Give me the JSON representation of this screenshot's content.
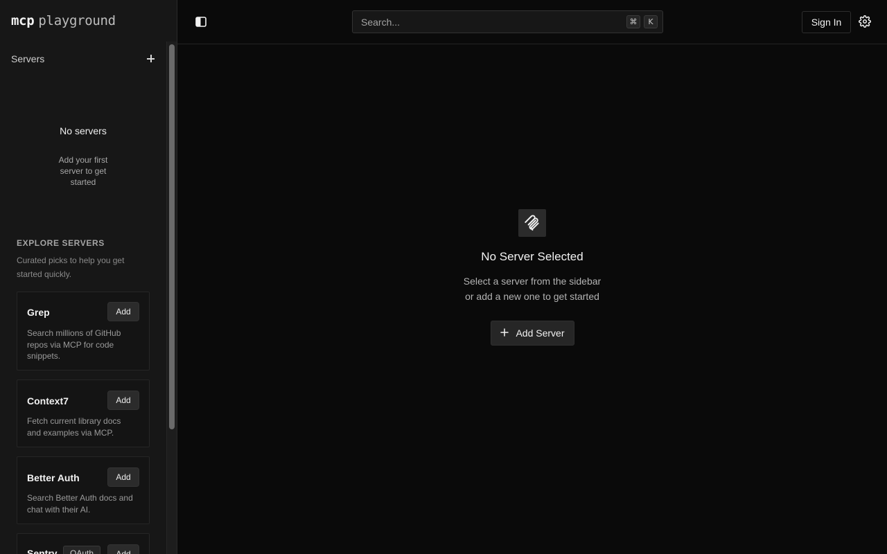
{
  "app": {
    "logo_bold": "mcp",
    "logo_light": "playground"
  },
  "sidebar": {
    "servers_title": "Servers",
    "empty_title": "No servers",
    "empty_subtitle": "Add your first server to get started",
    "explore_title": "EXPLORE SERVERS",
    "explore_subtitle": "Curated picks to help you get started quickly.",
    "cards": [
      {
        "name": "Grep",
        "add_label": "Add",
        "description": "Search millions of GitHub repos via MCP for code snippets."
      },
      {
        "name": "Context7",
        "add_label": "Add",
        "description": "Fetch current library docs and examples via MCP."
      },
      {
        "name": "Better Auth",
        "add_label": "Add",
        "description": "Search Better Auth docs and chat with their AI."
      },
      {
        "name": "Sentry",
        "badge": "OAuth",
        "add_label": "Add",
        "description": ""
      }
    ]
  },
  "topbar": {
    "search_placeholder": "Search...",
    "shortcut_modifier": "⌘",
    "shortcut_key": "K",
    "signin_label": "Sign In"
  },
  "main": {
    "empty_title": "No Server Selected",
    "empty_subtitle_line1": "Select a server from the sidebar",
    "empty_subtitle_line2": "or add a new one to get started",
    "add_server_label": "Add Server"
  },
  "colors": {
    "background": "#0a0a0a",
    "sidebar": "#171717",
    "button": "#262626",
    "text": "#f2f2f2",
    "muted": "#9a9a9a"
  },
  "icons": {
    "toggle": "sidebar-toggle-icon",
    "plus": "plus-icon",
    "gear": "gear-icon",
    "server": "mcp-logo-icon"
  }
}
